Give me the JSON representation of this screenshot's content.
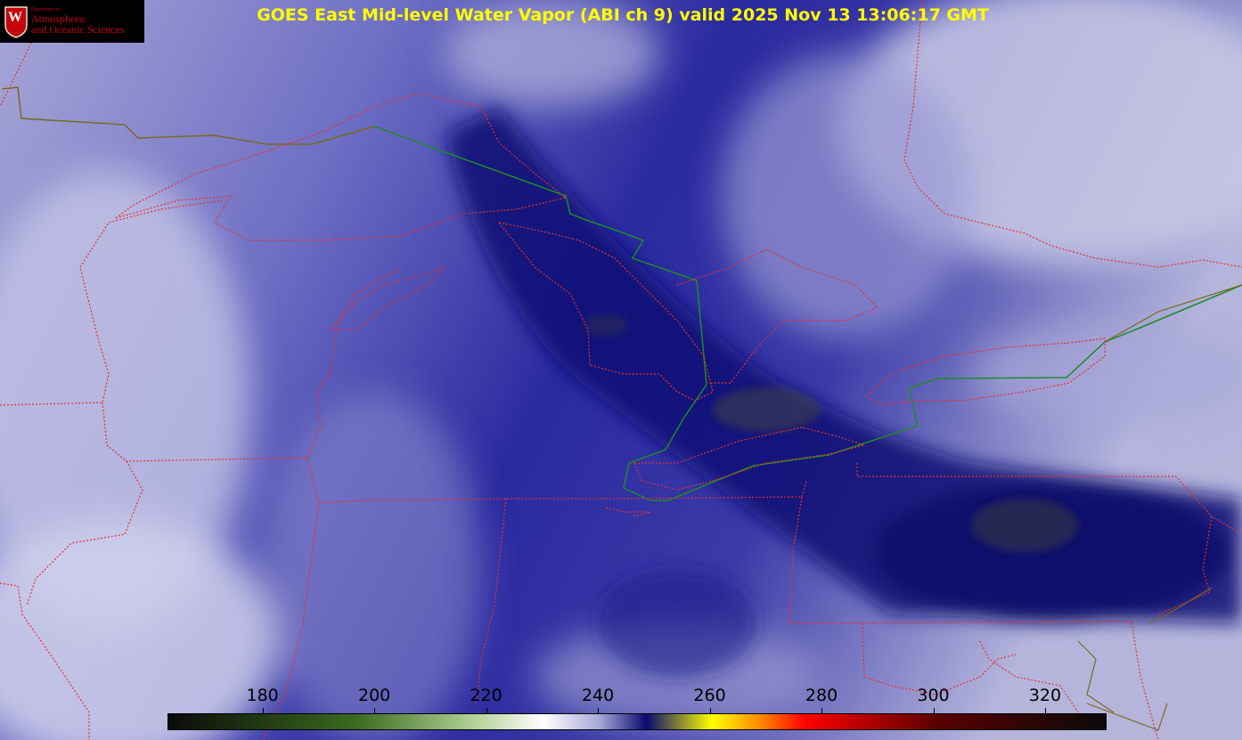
{
  "title": "GOES East Mid-level Water Vapor (ABI ch 9)  valid 2025 Nov 13 13:06:17 GMT",
  "logo": {
    "dept_line": "Department of",
    "line1": "Atmospheric",
    "line2": "and Oceanic Sciences",
    "seal_letter": "W"
  },
  "colorbar": {
    "tick_labels": [
      "180",
      "200",
      "220",
      "240",
      "260",
      "280",
      "300",
      "320"
    ],
    "range": [
      163,
      331
    ],
    "colors": {
      "dark": "#0a0a0a",
      "green": "#3a6b1f",
      "light_green": "#b6d49a",
      "white": "#ffffff",
      "lavender": "#a8a8d8",
      "navy": "#0a0a70",
      "yellow": "#ffff00",
      "orange": "#ff8c00",
      "red": "#ff0000",
      "dark_red": "#5a0000"
    }
  },
  "map": {
    "boundary_color": "#e53030",
    "border_color": "#1f8a2a",
    "coast_color": "#6b5a1e"
  }
}
